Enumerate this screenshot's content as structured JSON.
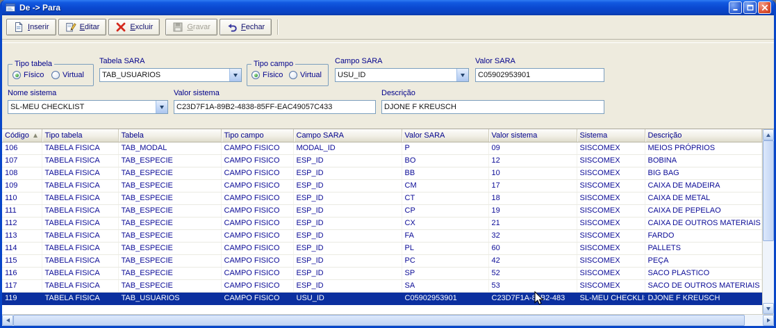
{
  "window": {
    "title": "De -> Para"
  },
  "toolbar": {
    "buttons": [
      {
        "label": "Inserir",
        "icon": "new-record-icon",
        "enabled": true
      },
      {
        "label": "Editar",
        "icon": "edit-record-icon",
        "enabled": true
      },
      {
        "label": "Excluir",
        "icon": "delete-record-icon",
        "enabled": true
      },
      {
        "label": "Gravar",
        "icon": "save-record-icon",
        "enabled": false
      },
      {
        "label": "Fechar",
        "icon": "undo-close-icon",
        "enabled": true
      }
    ]
  },
  "form": {
    "tipo_tabela": {
      "legend": "Tipo tabela",
      "options": [
        "Físico",
        "Virtual"
      ],
      "selected": "Físico"
    },
    "tabela_sara": {
      "label": "Tabela SARA",
      "value": "TAB_USUARIOS"
    },
    "tipo_campo": {
      "legend": "Tipo campo",
      "options": [
        "Físico",
        "Virtual"
      ],
      "selected": "Físico"
    },
    "campo_sara": {
      "label": "Campo SARA",
      "value": "USU_ID"
    },
    "valor_sara": {
      "label": "Valor SARA",
      "value": "C05902953901"
    },
    "nome_sistema": {
      "label": "Nome sistema",
      "value": "SL-MEU CHECKLIST"
    },
    "valor_sistema": {
      "label": "Valor sistema",
      "value": "C23D7F1A-89B2-4838-85FF-EAC49057C433"
    },
    "descricao": {
      "label": "Descrição",
      "value": "DJONE F KREUSCH"
    }
  },
  "grid": {
    "columns": [
      "Código",
      "Tipo tabela",
      "Tabela",
      "Tipo campo",
      "Campo SARA",
      "Valor SARA",
      "Valor sistema",
      "Sistema",
      "Descrição"
    ],
    "sort": {
      "column": "Código",
      "direction": "asc"
    },
    "selected_row_index": 12,
    "rows": [
      [
        "106",
        "TABELA FISICA",
        "TAB_MODAL",
        "CAMPO FISICO",
        "MODAL_ID",
        "P",
        "09",
        "SISCOMEX",
        "MEIOS PRÓPRIOS"
      ],
      [
        "107",
        "TABELA FISICA",
        "TAB_ESPECIE",
        "CAMPO FISICO",
        "ESP_ID",
        "BO",
        "12",
        "SISCOMEX",
        "BOBINA"
      ],
      [
        "108",
        "TABELA FISICA",
        "TAB_ESPECIE",
        "CAMPO FISICO",
        "ESP_ID",
        "BB",
        "10",
        "SISCOMEX",
        "BIG BAG"
      ],
      [
        "109",
        "TABELA FISICA",
        "TAB_ESPECIE",
        "CAMPO FISICO",
        "ESP_ID",
        "CM",
        "17",
        "SISCOMEX",
        "CAIXA DE MADEIRA"
      ],
      [
        "110",
        "TABELA FISICA",
        "TAB_ESPECIE",
        "CAMPO FISICO",
        "ESP_ID",
        "CT",
        "18",
        "SISCOMEX",
        "CAIXA DE METAL"
      ],
      [
        "111",
        "TABELA FISICA",
        "TAB_ESPECIE",
        "CAMPO FISICO",
        "ESP_ID",
        "CP",
        "19",
        "SISCOMEX",
        "CAIXA DE PEPELAO"
      ],
      [
        "112",
        "TABELA FISICA",
        "TAB_ESPECIE",
        "CAMPO FISICO",
        "ESP_ID",
        "CX",
        "21",
        "SISCOMEX",
        "CAIXA DE OUTROS MATERIAIS"
      ],
      [
        "113",
        "TABELA FISICA",
        "TAB_ESPECIE",
        "CAMPO FISICO",
        "ESP_ID",
        "FA",
        "32",
        "SISCOMEX",
        "FARDO"
      ],
      [
        "114",
        "TABELA FISICA",
        "TAB_ESPECIE",
        "CAMPO FISICO",
        "ESP_ID",
        "PL",
        "60",
        "SISCOMEX",
        "PALLETS"
      ],
      [
        "115",
        "TABELA FISICA",
        "TAB_ESPECIE",
        "CAMPO FISICO",
        "ESP_ID",
        "PC",
        "42",
        "SISCOMEX",
        "PEÇA"
      ],
      [
        "116",
        "TABELA FISICA",
        "TAB_ESPECIE",
        "CAMPO FISICO",
        "ESP_ID",
        "SP",
        "52",
        "SISCOMEX",
        "SACO PLASTICO"
      ],
      [
        "117",
        "TABELA FISICA",
        "TAB_ESPECIE",
        "CAMPO FISICO",
        "ESP_ID",
        "SA",
        "53",
        "SISCOMEX",
        "SACO DE OUTROS MATERIAIS"
      ],
      [
        "119",
        "TABELA FISICA",
        "TAB_USUARIOS",
        "CAMPO FISICO",
        "USU_ID",
        "C05902953901",
        "C23D7F1A-89B2-483",
        "SL-MEU CHECKLIST",
        "DJONE F KREUSCH"
      ]
    ]
  },
  "colors": {
    "titlebar_blue": "#0A47CE",
    "selection_blue": "#0B2F9F",
    "text_navy": "#00008B"
  }
}
